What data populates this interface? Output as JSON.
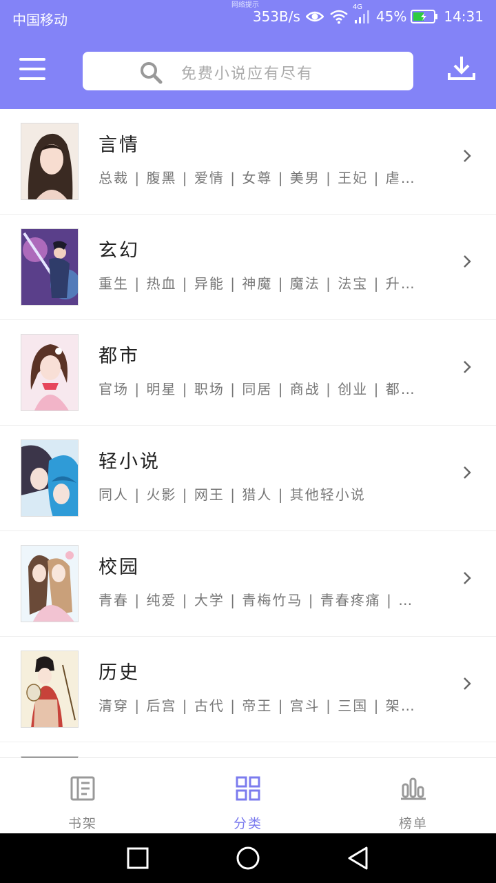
{
  "status_bar": {
    "carrier": "中国移动",
    "net_notice": "网络提示",
    "speed": "353B/s",
    "network": "4G",
    "battery": "45%",
    "time": "14:31"
  },
  "header": {
    "search_placeholder": "免费小说应有尽有",
    "icons": {
      "menu": "menu-icon",
      "search": "search-icon",
      "download": "download-icon"
    }
  },
  "colors": {
    "accent": "#8383f7",
    "active_tab": "#7b7bee"
  },
  "categories": [
    {
      "title": "言情",
      "tags": "总裁 | 腹黑 | 爱情 | 女尊 | 美男 | 王妃 | 虐…"
    },
    {
      "title": "玄幻",
      "tags": "重生 | 热血 | 异能 | 神魔 | 魔法 | 法宝 | 升…"
    },
    {
      "title": "都市",
      "tags": "官场 | 明星 | 职场 | 同居 | 商战 | 创业 | 都…"
    },
    {
      "title": "轻小说",
      "tags": "同人 | 火影 | 网王 | 猎人 | 其他轻小说"
    },
    {
      "title": "校园",
      "tags": "青春 | 纯爱 | 大学 | 青梅竹马 | 青春疼痛 | …"
    },
    {
      "title": "历史",
      "tags": "清穿 | 后宫 | 古代 | 帝王 | 宫斗 | 三国 | 架…"
    }
  ],
  "bottom_nav": [
    {
      "label": "书架",
      "icon": "bookshelf-icon",
      "active": false
    },
    {
      "label": "分类",
      "icon": "category-grid-icon",
      "active": true
    },
    {
      "label": "榜单",
      "icon": "ranking-icon",
      "active": false
    }
  ]
}
